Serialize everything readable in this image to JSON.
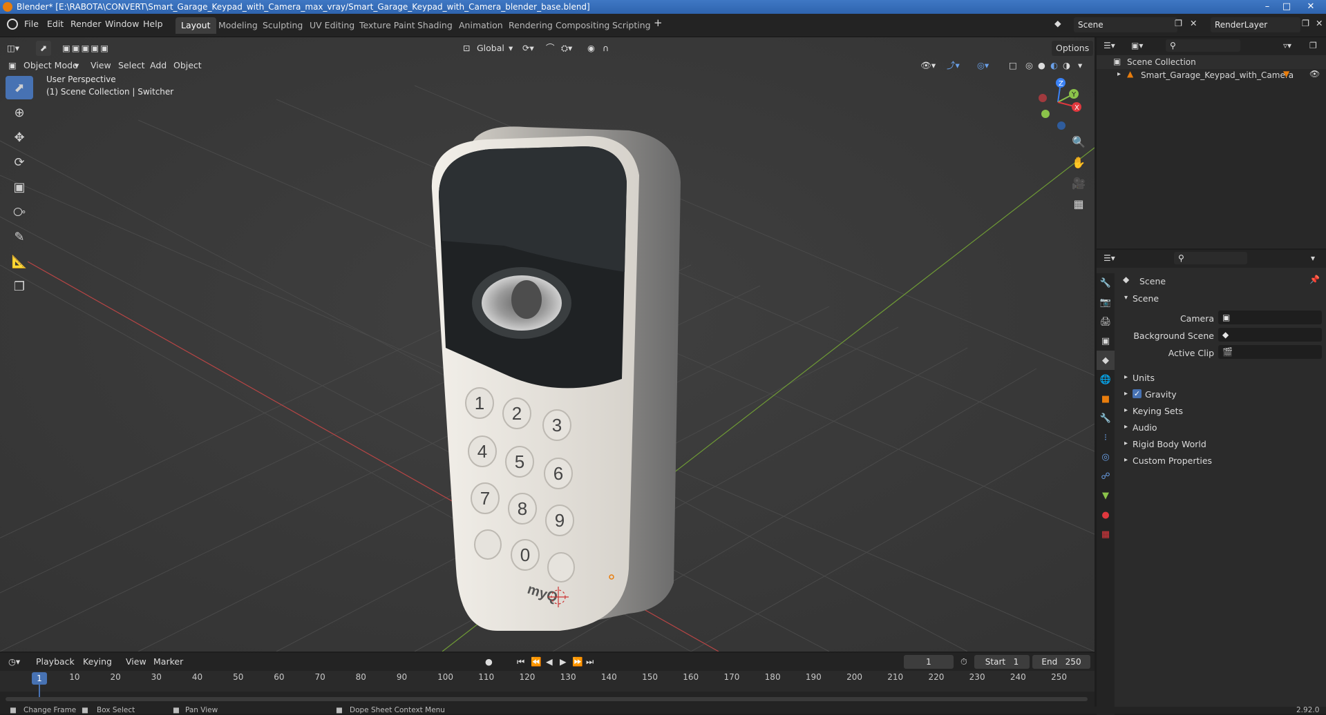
{
  "window": {
    "title": "Blender* [E:\\RABOTA\\CONVERT\\Smart_Garage_Keypad_with_Camera_max_vray/Smart_Garage_Keypad_with_Camera_blender_base.blend]",
    "min_icon": "minimize-icon",
    "max_icon": "maximize-icon",
    "close_icon": "close-icon"
  },
  "menu": {
    "file": "File",
    "edit": "Edit",
    "render": "Render",
    "window": "Window",
    "help": "Help"
  },
  "workspaces": [
    "Layout",
    "Modeling",
    "Sculpting",
    "UV Editing",
    "Texture Paint",
    "Shading",
    "Animation",
    "Rendering",
    "Compositing",
    "Scripting"
  ],
  "active_workspace": "Layout",
  "scene_field": "Scene",
  "renderlayer_field": "RenderLayer",
  "viewport_header": {
    "transform_orientation": "Global",
    "options": "Options",
    "mode": "Object Mode",
    "view": "View",
    "select": "Select",
    "add": "Add",
    "object": "Object"
  },
  "viewport_overlay": {
    "perspective": "User Perspective",
    "collection": "(1) Scene Collection | Switcher"
  },
  "keypad_keys": [
    "1",
    "2",
    "3",
    "4",
    "5",
    "6",
    "7",
    "8",
    "9",
    "0"
  ],
  "keypad_logo": "myQ",
  "outliner": {
    "root": "Scene Collection",
    "items": [
      {
        "label": "Smart_Garage_Keypad_with_Camera"
      }
    ]
  },
  "properties": {
    "breadcrumb": "Scene",
    "section": "Scene",
    "camera_label": "Camera",
    "background_scene_label": "Background Scene",
    "active_clip_label": "Active Clip",
    "panels": [
      "Units",
      "Gravity",
      "Keying Sets",
      "Audio",
      "Rigid Body World",
      "Custom Properties"
    ],
    "gravity_checked": true
  },
  "timeline": {
    "playback": "Playback",
    "keying": "Keying",
    "view": "View",
    "marker": "Marker",
    "current_frame": "1",
    "start_label": "Start",
    "start": "1",
    "end_label": "End",
    "end": "250",
    "ticks": [
      "1",
      "10",
      "20",
      "30",
      "40",
      "50",
      "60",
      "70",
      "80",
      "90",
      "100",
      "110",
      "120",
      "130",
      "140",
      "150",
      "160",
      "170",
      "180",
      "190",
      "200",
      "210",
      "220",
      "230",
      "240",
      "250"
    ]
  },
  "statusbar": {
    "change_frame": "Change Frame",
    "box_select": "Box Select",
    "pan_view": "Pan View",
    "context_menu": "Dope Sheet Context Menu",
    "version": "2.92.0"
  },
  "colors": {
    "accent": "#4772b3",
    "x_axis": "#e0383e",
    "y_axis": "#8bc34a",
    "z_axis": "#3b82f6",
    "body": "#e8e5df"
  }
}
